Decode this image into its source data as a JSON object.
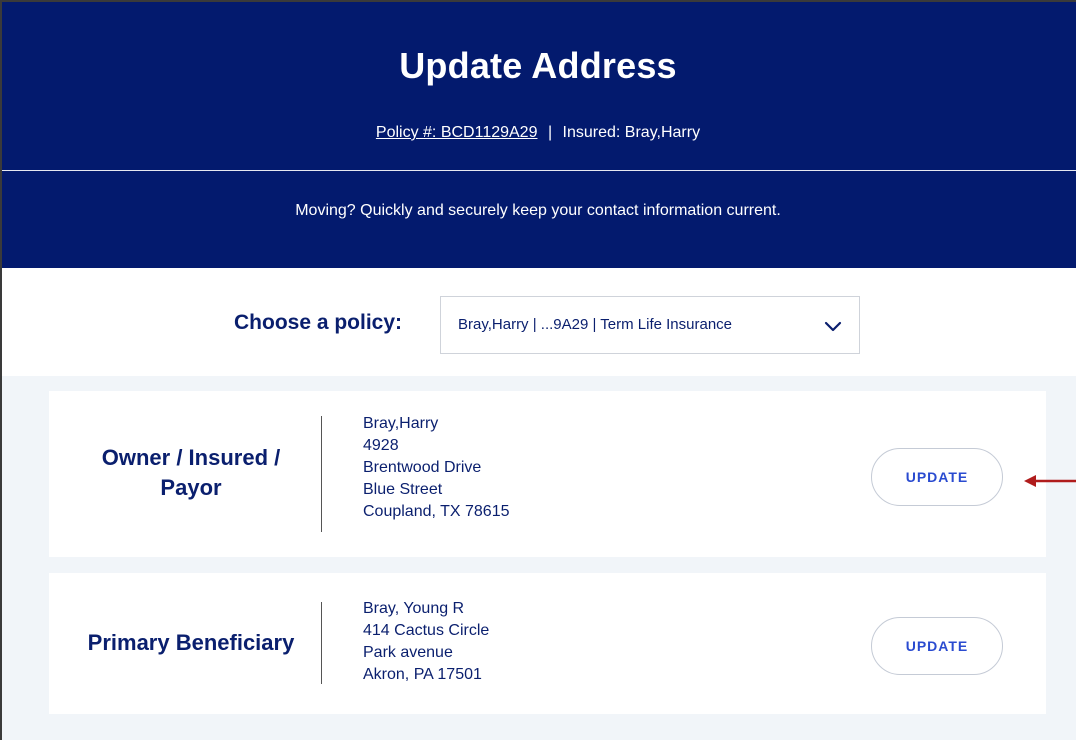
{
  "header": {
    "title": "Update Address",
    "policy_link": "Policy #: BCD1129A29",
    "separator": "|",
    "insured": "Insured: Bray,Harry",
    "moving_message": "Moving? Quickly and securely keep your contact information current."
  },
  "policy_selector": {
    "label": "Choose a policy:",
    "selected": "Bray,Harry | ...9A29 | Term Life Insurance",
    "icon": "chevron-down-icon"
  },
  "cards": [
    {
      "role_line1": "Owner / Insured /",
      "role_line2": "Payor",
      "address": [
        "Bray,Harry",
        "4928",
        "Brentwood Drive",
        "Blue Street",
        "Coupland, TX 78615"
      ],
      "button_label": "UPDATE"
    },
    {
      "role_line1": "Primary Beneficiary",
      "address": [
        "Bray, Young R",
        "414 Cactus Circle",
        "Park avenue",
        "Akron, PA 17501"
      ],
      "button_label": "UPDATE"
    }
  ],
  "colors": {
    "header_bg": "#031a6e",
    "accent_text": "#0a1f6e",
    "button_text": "#2a4bd0",
    "annotation_arrow": "#b01c1c"
  }
}
